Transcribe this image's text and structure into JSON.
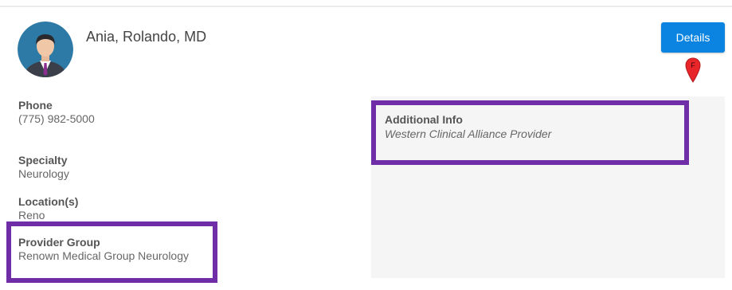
{
  "provider": {
    "name": "Ania, Rolando, MD"
  },
  "actions": {
    "details_label": "Details"
  },
  "map_pin": {
    "label": "F",
    "color": "#e8262a"
  },
  "fields": {
    "phone": {
      "label": "Phone",
      "value": "(775) 982-5000"
    },
    "specialty": {
      "label": "Specialty",
      "value": "Neurology"
    },
    "locations": {
      "label": "Location(s)",
      "value": "Reno"
    },
    "provider_group": {
      "label": "Provider Group",
      "value": "Renown Medical Group Neurology"
    }
  },
  "additional_info": {
    "label": "Additional Info",
    "value": "Western Clinical Alliance Provider"
  },
  "colors": {
    "accent": "#0a84e0",
    "highlight": "#6f2da8",
    "panel": "#f5f5f5"
  },
  "icons": {
    "avatar": "person-avatar-icon",
    "pin": "map-pin-icon"
  }
}
